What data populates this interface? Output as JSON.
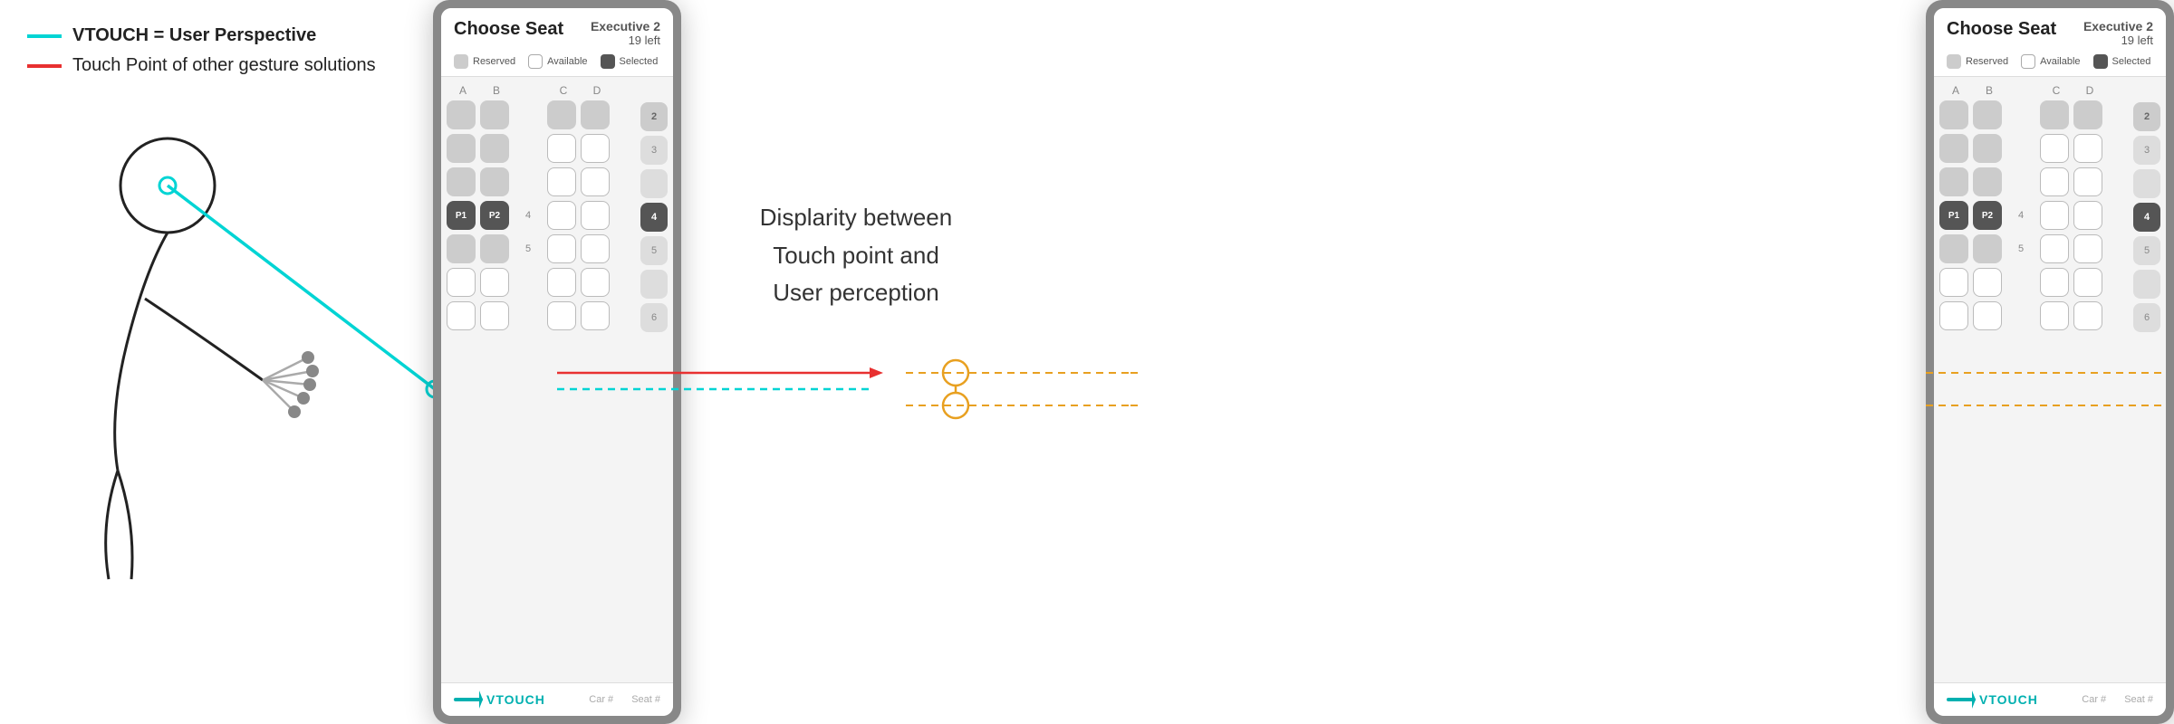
{
  "legend": {
    "item1": {
      "label": "VTOUCH = User Perspective",
      "color": "cyan"
    },
    "item2": {
      "label": "Touch Point of other gesture solutions",
      "color": "red"
    }
  },
  "left_tablet": {
    "title": "Choose Seat",
    "class_name": "Executive 2",
    "seats_left": "19 left",
    "legend": {
      "reserved": "Reserved",
      "available": "Available",
      "selected": "Selected"
    },
    "columns": [
      "A",
      "B",
      "C",
      "D"
    ],
    "rows": 7,
    "footer": {
      "car": "Car #",
      "seat": "Seat #"
    }
  },
  "right_tablet": {
    "title": "Choose Seat",
    "class_name": "Executive 2",
    "seats_left": "19 left",
    "legend": {
      "reserved": "Reserved",
      "available": "Available",
      "selected": "Selected"
    },
    "columns": [
      "A",
      "B",
      "C",
      "D"
    ],
    "rows": 7,
    "footer": {
      "car": "Car #",
      "seat": "Seat #"
    },
    "highlighted_seats": [
      "P1",
      "P2"
    ]
  },
  "middle": {
    "disparity_line1": "Displarity between",
    "disparity_line2": "Touch point and",
    "disparity_line3": "User perception"
  }
}
